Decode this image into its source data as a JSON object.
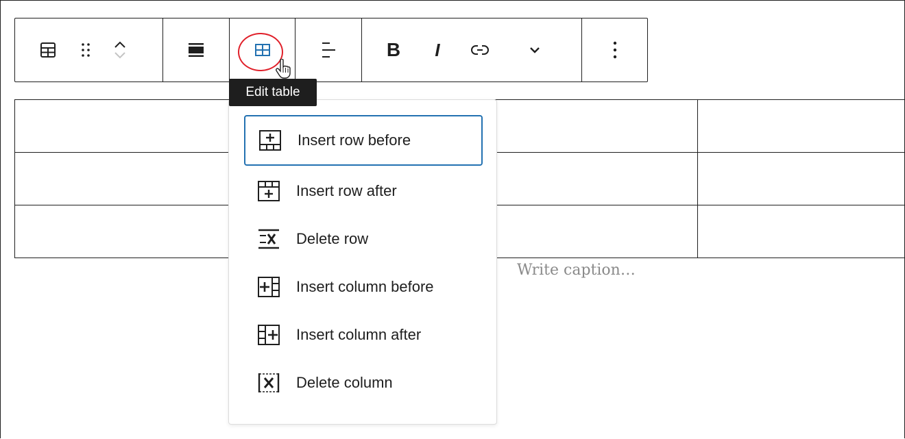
{
  "toolbar": {
    "groups": [
      {
        "name": "block",
        "items": [
          "table-icon",
          "drag-handle-icon",
          "move-up-down-icon"
        ]
      },
      {
        "name": "align",
        "items": [
          "align-wide-icon"
        ]
      },
      {
        "name": "edit-table",
        "items": [
          "edit-table-icon"
        ]
      },
      {
        "name": "text-align",
        "items": [
          "text-align-icon"
        ]
      },
      {
        "name": "format",
        "items": [
          "bold-icon",
          "italic-icon",
          "link-icon",
          "chevron-down-icon"
        ]
      },
      {
        "name": "options",
        "items": [
          "more-options-icon"
        ]
      }
    ],
    "bold_label": "B",
    "italic_label": "I"
  },
  "tooltip": {
    "text": "Edit table"
  },
  "table": {
    "rows": 3,
    "columns": 3
  },
  "caption": {
    "placeholder": "Write caption…"
  },
  "menu": {
    "items": [
      {
        "label": "Insert row before",
        "icon": "insert-row-before-icon",
        "active": true
      },
      {
        "label": "Insert row after",
        "icon": "insert-row-after-icon",
        "active": false
      },
      {
        "label": "Delete row",
        "icon": "delete-row-icon",
        "active": false
      },
      {
        "label": "Insert column before",
        "icon": "insert-column-before-icon",
        "active": false
      },
      {
        "label": "Insert column after",
        "icon": "insert-column-after-icon",
        "active": false
      },
      {
        "label": "Delete column",
        "icon": "delete-column-icon",
        "active": false
      }
    ]
  },
  "colors": {
    "accent": "#2271b1",
    "highlight": "#e0202a",
    "text": "#1e1e1e",
    "muted": "#8a8a8a"
  }
}
